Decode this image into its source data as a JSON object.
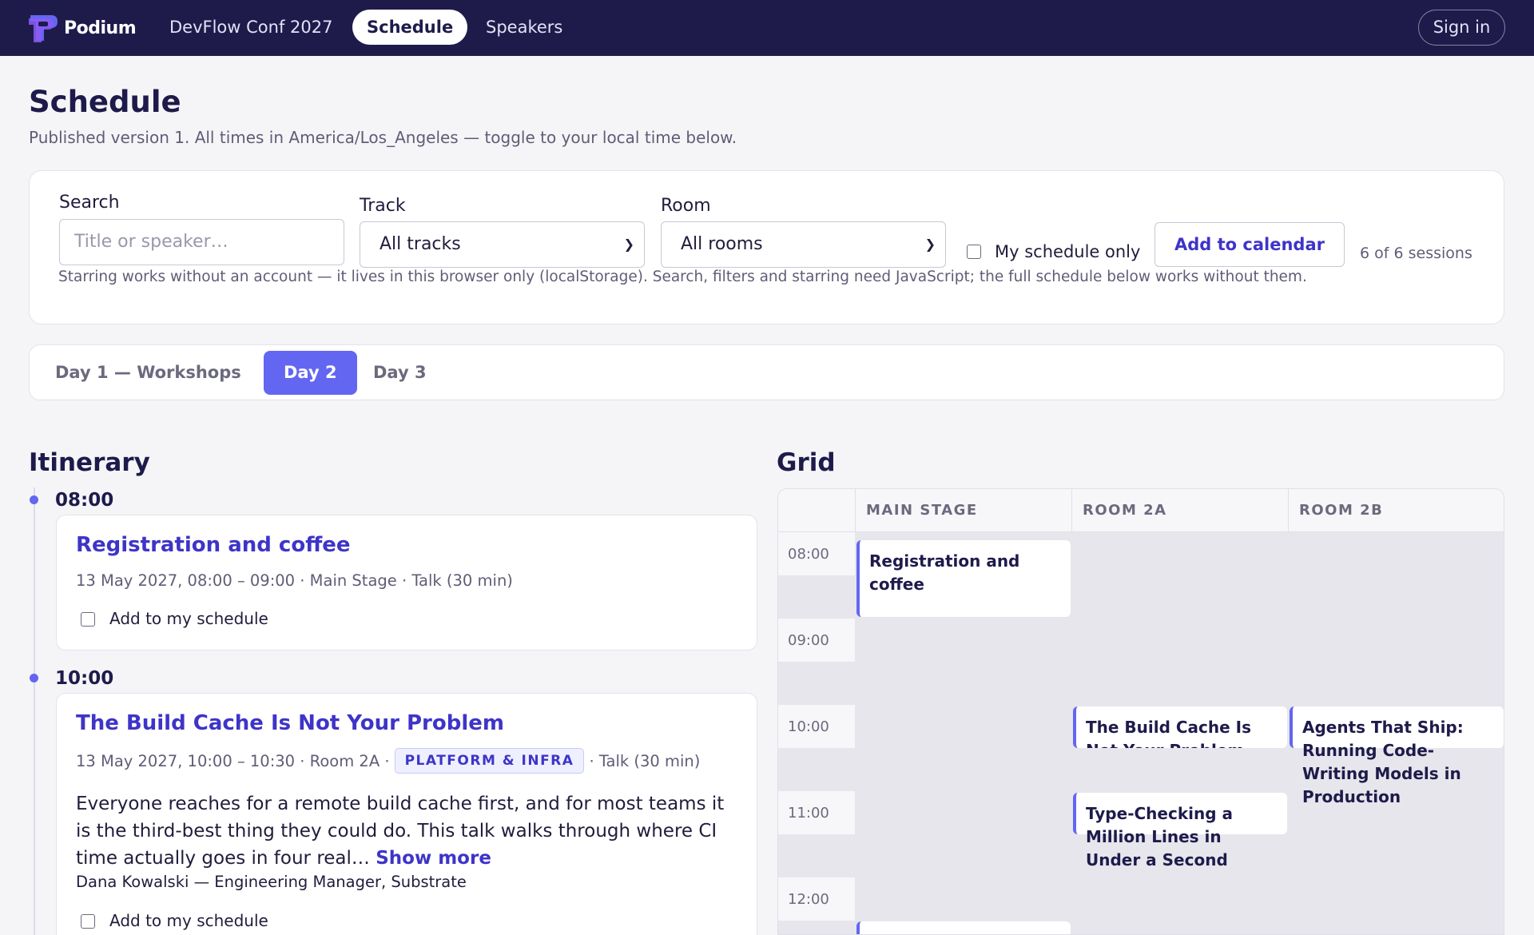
{
  "nav": {
    "brand": "Podium",
    "links": [
      "DevFlow Conf 2027",
      "Schedule",
      "Speakers"
    ],
    "active": "Schedule",
    "sign_in": "Sign in"
  },
  "header": {
    "title": "Schedule",
    "subtitle": "Published version 1. All times in America/Los_Angeles — toggle to your local time below."
  },
  "filters": {
    "search_label": "Search",
    "search_placeholder": "Title or speaker…",
    "track_label": "Track",
    "track_value": "All tracks",
    "room_label": "Room",
    "room_value": "All rooms",
    "my_schedule_label": "My schedule only",
    "add_calendar": "Add to calendar",
    "count": "6 of 6 sessions",
    "note": "Starring works without an account — it lives in this browser only (localStorage). Search, filters and starring need JavaScript; the full schedule below works without them."
  },
  "days": [
    "Day 1 — Workshops",
    "Day 2",
    "Day 3"
  ],
  "active_day": "Day 2",
  "itinerary": {
    "title": "Itinerary",
    "slots": [
      {
        "time": "08:00",
        "session": {
          "title": "Registration and coffee",
          "meta": "13 May 2027, 08:00 – 09:00 · Main Stage · Talk (30 min)",
          "add_label": "Add to my schedule"
        }
      },
      {
        "time": "10:00",
        "session": {
          "title": "The Build Cache Is Not Your Problem",
          "meta_before": "13 May 2027, 10:00 – 10:30 · Room 2A ·",
          "track": "PLATFORM & INFRA",
          "meta_after": "· Talk (30 min)",
          "description": "Everyone reaches for a remote build cache first, and for most teams it is the third-best thing they could do. This talk walks through where CI time actually goes in four real…",
          "show_more": "Show more",
          "speaker": "Dana Kowalski — Engineering Manager, Substrate",
          "add_label": "Add to my schedule"
        }
      }
    ]
  },
  "grid": {
    "title": "Grid",
    "columns": [
      "MAIN STAGE",
      "ROOM 2A",
      "ROOM 2B"
    ],
    "times": [
      "08:00",
      "09:00",
      "10:00",
      "11:00",
      "12:00"
    ],
    "sessions": [
      {
        "title": "Registration and coffee",
        "room": "MAIN STAGE",
        "start": "08:00"
      },
      {
        "title": "The Build Cache Is Not Your Problem",
        "room": "ROOM 2A",
        "start": "10:00"
      },
      {
        "title": "Agents That Ship: Running Code-Writing Models in Production",
        "room": "ROOM 2B",
        "start": "10:00"
      },
      {
        "title": "Type-Checking a Million Lines in Under a Second",
        "room": "ROOM 2A",
        "start": "11:00"
      }
    ]
  },
  "colors": {
    "nav_bg": "#1e1b4b",
    "accent": "#6366f1",
    "link": "#3e34c9"
  }
}
